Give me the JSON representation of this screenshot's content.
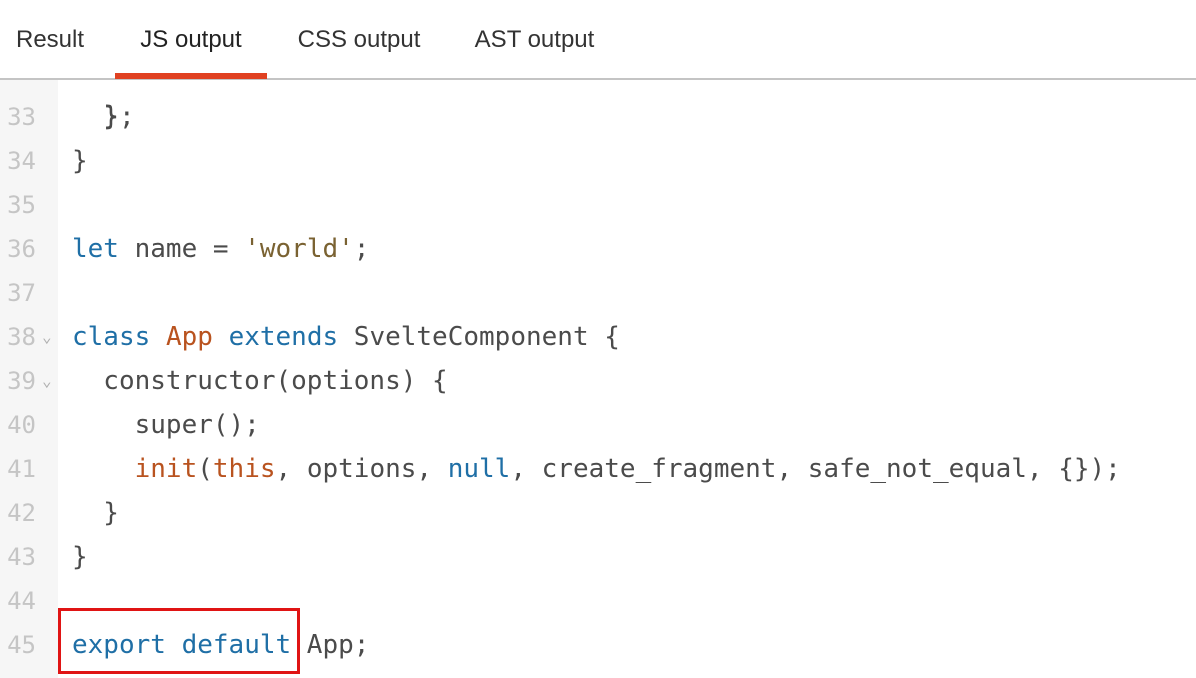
{
  "tabs": [
    {
      "label": "Result",
      "active": false
    },
    {
      "label": "JS output",
      "active": true
    },
    {
      "label": "CSS output",
      "active": false
    },
    {
      "label": "AST output",
      "active": false
    }
  ],
  "colors": {
    "accent": "#e04121",
    "keyword": "#1f6fa6",
    "string": "#7a6232",
    "definition": "#b9531f",
    "text": "#4b4b4b",
    "line_number": "#c5c5c5",
    "highlight": "#e01414"
  },
  "code": {
    "partial_top": "  }",
    "lines": [
      {
        "n": "33",
        "fold": false,
        "tokens": [
          {
            "t": "  };",
            "c": ""
          }
        ]
      },
      {
        "n": "34",
        "fold": false,
        "tokens": [
          {
            "t": "}",
            "c": ""
          }
        ]
      },
      {
        "n": "35",
        "fold": false,
        "tokens": []
      },
      {
        "n": "36",
        "fold": false,
        "tokens": [
          {
            "t": "let",
            "c": "kw"
          },
          {
            "t": " name = ",
            "c": ""
          },
          {
            "t": "'world'",
            "c": "str"
          },
          {
            "t": ";",
            "c": ""
          }
        ]
      },
      {
        "n": "37",
        "fold": false,
        "tokens": []
      },
      {
        "n": "38",
        "fold": true,
        "tokens": [
          {
            "t": "class",
            "c": "kw"
          },
          {
            "t": " ",
            "c": ""
          },
          {
            "t": "App",
            "c": "def"
          },
          {
            "t": " ",
            "c": ""
          },
          {
            "t": "extends",
            "c": "kw"
          },
          {
            "t": " SvelteComponent {",
            "c": ""
          }
        ]
      },
      {
        "n": "39",
        "fold": true,
        "tokens": [
          {
            "t": "  constructor(options) {",
            "c": ""
          }
        ]
      },
      {
        "n": "40",
        "fold": false,
        "tokens": [
          {
            "t": "    super();",
            "c": ""
          }
        ]
      },
      {
        "n": "41",
        "fold": false,
        "tokens": [
          {
            "t": "    ",
            "c": ""
          },
          {
            "t": "init",
            "c": "def"
          },
          {
            "t": "(",
            "c": ""
          },
          {
            "t": "this",
            "c": "def"
          },
          {
            "t": ", options, ",
            "c": ""
          },
          {
            "t": "null",
            "c": "kw"
          },
          {
            "t": ", create_fragment, safe_not_equal, {});",
            "c": ""
          }
        ]
      },
      {
        "n": "42",
        "fold": false,
        "tokens": [
          {
            "t": "  }",
            "c": ""
          }
        ]
      },
      {
        "n": "43",
        "fold": false,
        "tokens": [
          {
            "t": "}",
            "c": ""
          }
        ]
      },
      {
        "n": "44",
        "fold": false,
        "tokens": []
      },
      {
        "n": "45",
        "fold": false,
        "tokens": [
          {
            "t": "export",
            "c": "kw"
          },
          {
            "t": " ",
            "c": ""
          },
          {
            "t": "default",
            "c": "kw"
          },
          {
            "t": " App;",
            "c": ""
          }
        ]
      }
    ]
  },
  "fold_icon": "chevron-down-icon"
}
